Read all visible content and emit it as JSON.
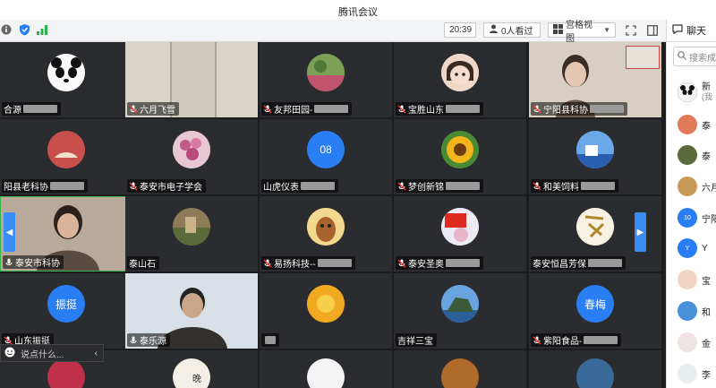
{
  "window": {
    "title": "腾讯会议"
  },
  "toolbar": {
    "timer": "20:39",
    "viewers": "0人看过",
    "grid_view": "宫格视图",
    "chat_tab": "聊天"
  },
  "tiles": [
    {
      "label": "合源",
      "masked": true
    },
    {
      "label": "六月飞雪",
      "masked": false
    },
    {
      "label": "友邦田园-",
      "masked": true
    },
    {
      "label": "宝胜山东",
      "masked": true
    },
    {
      "label": "宁阳县科协",
      "masked": true
    },
    {
      "label": "阳县老科协",
      "masked": true
    },
    {
      "label": "泰安市电子学会",
      "masked": false
    },
    {
      "label": "山虎仪表",
      "masked": true
    },
    {
      "label": "梦创新锦",
      "masked": true
    },
    {
      "label": "和美饲料",
      "masked": true
    },
    {
      "label": "泰安市科协",
      "masked": false
    },
    {
      "label": "泰山石",
      "masked": false
    },
    {
      "label": "易扬科技--",
      "masked": true
    },
    {
      "label": "泰安圣奥",
      "masked": true
    },
    {
      "label": "泰安恒昌芳保",
      "masked": true
    },
    {
      "label": "山东振挺",
      "masked": false
    },
    {
      "label": "泰乐源",
      "masked": false
    },
    {
      "label": "",
      "masked": true
    },
    {
      "label": "吉祥三宝",
      "masked": false
    },
    {
      "label": "紫阳食品-",
      "masked": true
    }
  ],
  "avatar_text": {
    "shanhu": "08",
    "zhenting": "振挺",
    "chunmei": "春梅",
    "wan": "晚"
  },
  "chat": {
    "placeholder": "说点什么..."
  },
  "sidebar": {
    "search_placeholder": "搜索成",
    "members": [
      {
        "name": "新",
        "sub": "(我"
      },
      {
        "name": "泰"
      },
      {
        "name": "泰"
      },
      {
        "name": "六月"
      },
      {
        "name": "宁阳",
        "avatar": "10"
      },
      {
        "name": "Y",
        "avatar": "Y"
      },
      {
        "name": "宝"
      },
      {
        "name": "和"
      },
      {
        "name": "金"
      },
      {
        "name": "李"
      }
    ]
  }
}
